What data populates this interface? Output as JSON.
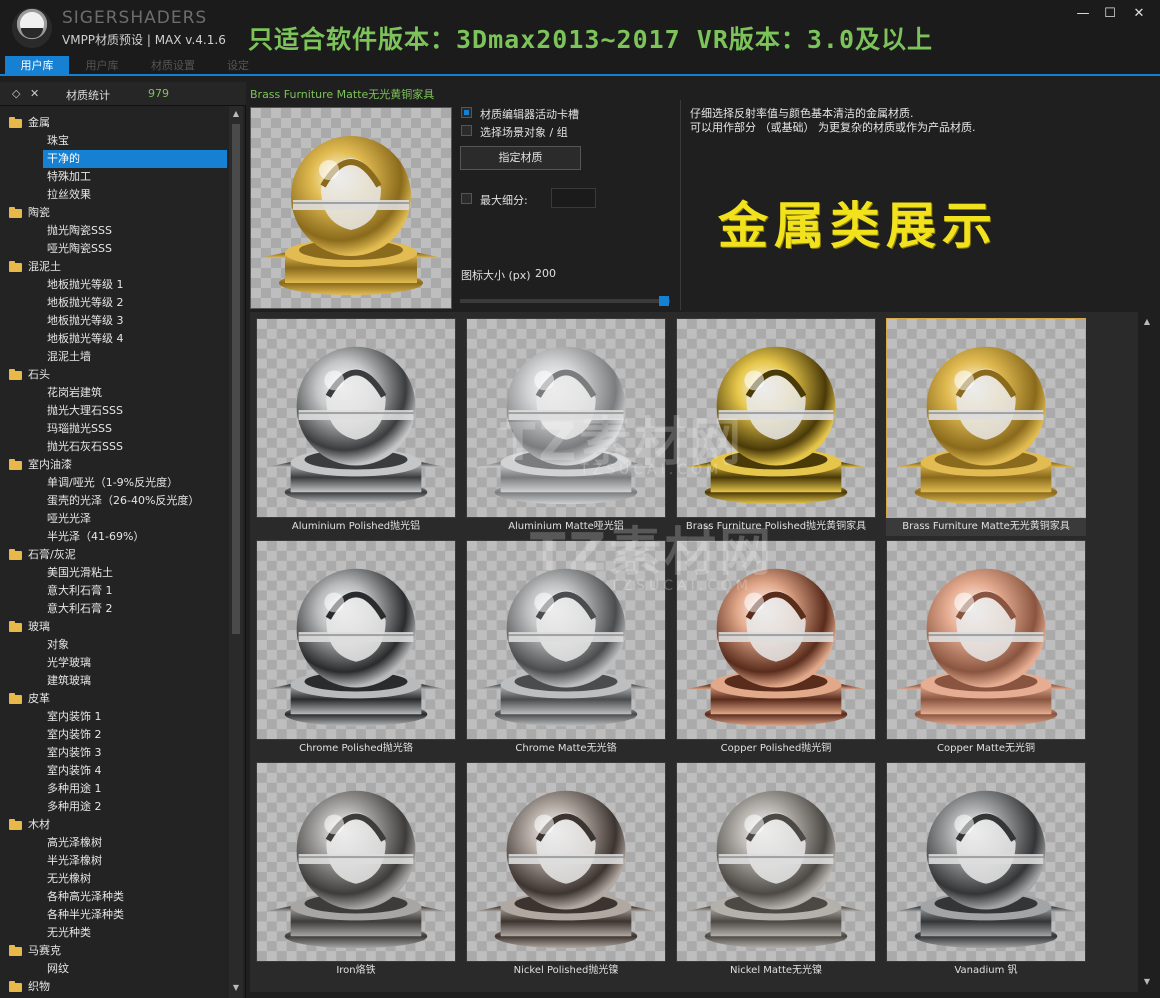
{
  "window": {
    "brand": "SIGERSHADERS",
    "subtitle": "VMPP材质预设 | MAX v.4.1.6",
    "banner": "只适合软件版本：3Dmax2013~2017  VR版本：3.0及以上",
    "minimize_glyph": "—",
    "maximize_glyph": "☐",
    "close_glyph": "✕"
  },
  "tabs": [
    {
      "label": "用户库",
      "active": true
    },
    {
      "label": "用户库",
      "active": false
    },
    {
      "label": "材质设置",
      "active": false
    },
    {
      "label": "设定",
      "active": false
    }
  ],
  "left_panel": {
    "stats_label": "材质统计",
    "stats_count": "979",
    "tree": [
      {
        "type": "cat",
        "label": "金属"
      },
      {
        "type": "sub",
        "label": "珠宝"
      },
      {
        "type": "sel",
        "label": "干净的"
      },
      {
        "type": "sub",
        "label": "特殊加工"
      },
      {
        "type": "sub",
        "label": "拉丝效果"
      },
      {
        "type": "cat",
        "label": "陶瓷"
      },
      {
        "type": "sub",
        "label": "抛光陶瓷SSS"
      },
      {
        "type": "sub",
        "label": "哑光陶瓷SSS"
      },
      {
        "type": "cat",
        "label": "混泥土"
      },
      {
        "type": "sub",
        "label": "地板抛光等级 1"
      },
      {
        "type": "sub",
        "label": "地板抛光等级 2"
      },
      {
        "type": "sub",
        "label": "地板抛光等级 3"
      },
      {
        "type": "sub",
        "label": "地板抛光等级 4"
      },
      {
        "type": "sub",
        "label": "混泥土墙"
      },
      {
        "type": "cat",
        "label": "石头"
      },
      {
        "type": "sub",
        "label": "花岗岩建筑"
      },
      {
        "type": "sub",
        "label": "抛光大理石SSS"
      },
      {
        "type": "sub",
        "label": "玛瑙抛光SSS"
      },
      {
        "type": "sub",
        "label": "抛光石灰石SSS"
      },
      {
        "type": "cat",
        "label": "室内油漆"
      },
      {
        "type": "sub",
        "label": "单调/哑光（1-9%反光度）"
      },
      {
        "type": "sub",
        "label": "蛋壳的光泽（26-40%反光度）"
      },
      {
        "type": "sub",
        "label": "哑光光泽"
      },
      {
        "type": "sub",
        "label": "半光泽（41-69%）"
      },
      {
        "type": "cat",
        "label": "石膏/灰泥"
      },
      {
        "type": "sub",
        "label": "美国光滑粘土"
      },
      {
        "type": "sub",
        "label": "意大利石膏 1"
      },
      {
        "type": "sub",
        "label": "意大利石膏 2"
      },
      {
        "type": "cat",
        "label": "玻璃"
      },
      {
        "type": "sub",
        "label": "对象"
      },
      {
        "type": "sub",
        "label": "光学玻璃"
      },
      {
        "type": "sub",
        "label": "建筑玻璃"
      },
      {
        "type": "cat",
        "label": "皮革"
      },
      {
        "type": "sub",
        "label": "室内装饰 1"
      },
      {
        "type": "sub",
        "label": "室内装饰 2"
      },
      {
        "type": "sub",
        "label": "室内装饰 3"
      },
      {
        "type": "sub",
        "label": "室内装饰 4"
      },
      {
        "type": "sub",
        "label": "多种用途 1"
      },
      {
        "type": "sub",
        "label": "多种用途 2"
      },
      {
        "type": "cat",
        "label": "木材"
      },
      {
        "type": "sub",
        "label": "高光泽橡树"
      },
      {
        "type": "sub",
        "label": "半光泽橡树"
      },
      {
        "type": "sub",
        "label": "无光橡树"
      },
      {
        "type": "sub",
        "label": "各种高光泽种类"
      },
      {
        "type": "sub",
        "label": "各种半光泽种类"
      },
      {
        "type": "sub",
        "label": "无光种类"
      },
      {
        "type": "cat",
        "label": "马赛克"
      },
      {
        "type": "sub",
        "label": "网纹"
      },
      {
        "type": "cat",
        "label": "织物"
      }
    ]
  },
  "preview": {
    "material_title": "Brass Furniture Matte无光黄铜家具",
    "opt_editor_label": "材质编辑器活动卡槽",
    "opt_editor_checked": true,
    "opt_scene_label": "选择场景对象 / 组",
    "opt_scene_checked": false,
    "assign_button": "指定材质",
    "max_subdiv_label": "最大细分:",
    "max_subdiv_checked": false,
    "icon_size_label": "图标大小 (px)",
    "icon_size_value": "200",
    "description_line1": "仔细选择反射率值与颜色基本清洁的金属材质.",
    "description_line2": "可以用作部分 （或基础） 为更复杂的材质或作为产品材质.",
    "overlay_text": "金属类展示"
  },
  "grid": [
    {
      "label": "Aluminium Polished抛光铝",
      "color": "#c4c6c8",
      "dark": "#3a3c3e",
      "selected": false
    },
    {
      "label": "Aluminium Matte哑光铝",
      "color": "#d0d2d4",
      "dark": "#7a7c7e",
      "selected": false
    },
    {
      "label": "Brass Furniture Polished抛光黄铜家具",
      "color": "#e6c64a",
      "dark": "#4a3a08",
      "selected": false
    },
    {
      "label": "Brass Furniture Matte无光黄铜家具",
      "color": "#e2bc52",
      "dark": "#8a6a1c",
      "selected": true
    },
    {
      "label": "Chrome Polished抛光铬",
      "color": "#b8babc",
      "dark": "#2a2b2c",
      "selected": false
    },
    {
      "label": "Chrome Matte无光铬",
      "color": "#bcbec0",
      "dark": "#4a4c4e",
      "selected": false
    },
    {
      "label": "Copper Polished抛光铜",
      "color": "#e2a88a",
      "dark": "#5a2c1c",
      "selected": false
    },
    {
      "label": "Copper Matte无光铜",
      "color": "#e6ad92",
      "dark": "#8a5540",
      "selected": false
    },
    {
      "label": "Iron烙铁",
      "color": "#a8a6a4",
      "dark": "#3e3c3a",
      "selected": false
    },
    {
      "label": "Nickel Polished抛光镍",
      "color": "#b2a8a2",
      "dark": "#3c3430",
      "selected": false
    },
    {
      "label": "Nickel Matte无光镍",
      "color": "#b4b0ac",
      "dark": "#4c4844",
      "selected": false
    },
    {
      "label": "Vanadium 钒",
      "color": "#a2a4a6",
      "dark": "#333537",
      "selected": false
    }
  ],
  "watermarks": {
    "big": "TZ素材网",
    "small": "TZSUCAI.COM"
  },
  "colors": {
    "accent": "#1680d2",
    "green_text": "#7cc35a",
    "yellow_overlay": "#f2e21e"
  }
}
